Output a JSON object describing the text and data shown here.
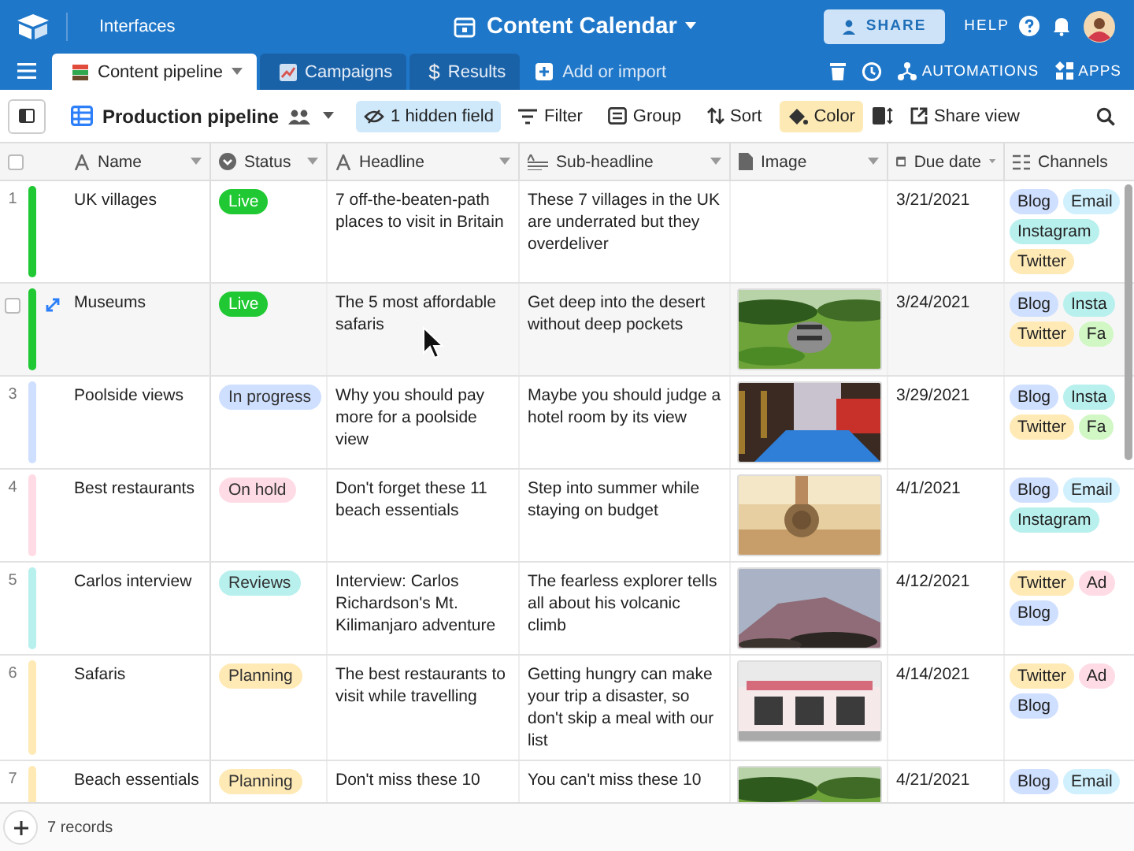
{
  "top_bar": {
    "section": "Interfaces",
    "base_title": "Content Calendar",
    "share": "SHARE",
    "help": "HELP"
  },
  "tabs": [
    {
      "label": "Content pipeline",
      "selected": true
    },
    {
      "label": "Campaigns",
      "selected": false
    },
    {
      "label": "Results",
      "selected": false,
      "symbol": "$"
    }
  ],
  "add_tab": "Add or import",
  "tab_actions": {
    "automations": "AUTOMATIONS",
    "apps": "APPS"
  },
  "view": {
    "name": "Production pipeline"
  },
  "toolbar": [
    {
      "label": "1 hidden field",
      "color": "#cfe9fb"
    },
    {
      "label": "Filter"
    },
    {
      "label": "Group"
    },
    {
      "label": "Sort"
    },
    {
      "label": "Color",
      "color": "#fde9b4"
    }
  ],
  "share_view": "Share view",
  "select_all": {
    "checked": false
  },
  "columns": [
    {
      "label": "Name",
      "kind": "text",
      "menu": true
    },
    {
      "label": "Status",
      "kind": "status",
      "menu": true
    },
    {
      "label": "Headline",
      "kind": "text",
      "menu": true
    },
    {
      "label": "Sub-headline",
      "kind": "longtext",
      "menu": true
    },
    {
      "label": "Image",
      "kind": "attachment",
      "menu": true
    },
    {
      "label": "Due date",
      "kind": "date",
      "menu": true
    },
    {
      "label": "Channels",
      "kind": "list",
      "menu": false
    }
  ],
  "rows": [
    {
      "number": "1",
      "hovered": false,
      "color": "#20c933",
      "name": "UK villages",
      "status": {
        "label": "Live",
        "color": "#20c933"
      },
      "headline": "7 off-the-beaten-path places to visit in Britain",
      "subheadline": "These 7 villages in the UK are underrated but they overdeliver",
      "due": "3/21/2021",
      "channels": [
        {
          "label": "Blog",
          "color": "#cfdfff"
        },
        {
          "label": "Email",
          "color": "#d0f0fd"
        },
        {
          "label": "Instagram",
          "color": "#b8f0ee"
        },
        {
          "label": "Twitter",
          "color": "#ffeab6"
        }
      ]
    },
    {
      "hovered": true,
      "checked": false,
      "color": "#20c933",
      "name": "Museums",
      "status": {
        "label": "Live",
        "color": "#20c933"
      },
      "headline": "The 5 most affordable safaris",
      "subheadline": "Get deep into the desert without deep pockets",
      "image": {
        "kind": "picture"
      },
      "due": "3/24/2021",
      "channels": [
        {
          "label": "Blog",
          "color": "#cfdfff"
        },
        {
          "label": "Insta",
          "color": "#b8f0ee"
        },
        {
          "label": "Twitter",
          "color": "#ffeab6"
        },
        {
          "label": "Fa",
          "color": "#d1f7c4"
        }
      ]
    },
    {
      "number": "3",
      "hovered": false,
      "color": "#cfdfff",
      "name": "Poolside views",
      "status": {
        "label": "In progress",
        "color": "#cfdfff"
      },
      "headline": "Why you should pay more for a poolside view",
      "subheadline": "Maybe you should judge a hotel room by its view",
      "image": {
        "kind": "picture"
      },
      "due": "3/29/2021",
      "channels": [
        {
          "label": "Blog",
          "color": "#cfdfff"
        },
        {
          "label": "Insta",
          "color": "#b8f0ee"
        },
        {
          "label": "Twitter",
          "color": "#ffeab6"
        },
        {
          "label": "Fa",
          "color": "#d1f7c4"
        }
      ]
    },
    {
      "number": "4",
      "hovered": false,
      "color": "#ffdce5",
      "name": "Best restaurants",
      "status": {
        "label": "On hold",
        "color": "#ffdce5"
      },
      "headline": "Don't forget these 11 beach essentials",
      "subheadline": "Step into summer while staying on budget",
      "image": {
        "kind": "picture"
      },
      "due": "4/1/2021",
      "channels": [
        {
          "label": "Blog",
          "color": "#cfdfff"
        },
        {
          "label": "Email",
          "color": "#d0f0fd"
        },
        {
          "label": "Instagram",
          "color": "#b8f0ee"
        }
      ]
    },
    {
      "number": "5",
      "hovered": false,
      "color": "#b8f0ee",
      "name": "Carlos interview",
      "status": {
        "label": "Reviews",
        "color": "#b8f0ee"
      },
      "headline": "Interview: Carlos Richardson's Mt. Kilimanjaro adventure",
      "subheadline": "The fearless explorer tells all about his volcanic climb",
      "image": {
        "kind": "picture"
      },
      "due": "4/12/2021",
      "channels": [
        {
          "label": "Twitter",
          "color": "#ffeab6"
        },
        {
          "label": "Ad",
          "color": "#ffdce5"
        },
        {
          "label": "Blog",
          "color": "#cfdfff"
        }
      ]
    },
    {
      "number": "6",
      "hovered": false,
      "color": "#ffeab6",
      "name": "Safaris",
      "status": {
        "label": "Planning",
        "color": "#ffeab6"
      },
      "headline": "The best restaurants to visit while travelling",
      "subheadline": "Getting hungry can make your trip a disaster, so don't skip a meal with our list",
      "image": {
        "kind": "picture"
      },
      "due": "4/14/2021",
      "channels": [
        {
          "label": "Twitter",
          "color": "#ffeab6"
        },
        {
          "label": "Ad",
          "color": "#ffdce5"
        },
        {
          "label": "Blog",
          "color": "#cfdfff"
        }
      ]
    },
    {
      "number": "7",
      "hovered": false,
      "color": "#ffeab6",
      "name": "Beach essentials",
      "status": {
        "label": "Planning",
        "color": "#ffeab6"
      },
      "headline": "Don't miss these 10",
      "subheadline": "You can't miss these 10",
      "image": {
        "kind": "picture"
      },
      "due": "4/21/2021",
      "channels": [
        {
          "label": "Blog",
          "color": "#cfdfff"
        },
        {
          "label": "Email",
          "color": "#d0f0fd"
        }
      ]
    }
  ],
  "footer": {
    "count": "7 records"
  }
}
